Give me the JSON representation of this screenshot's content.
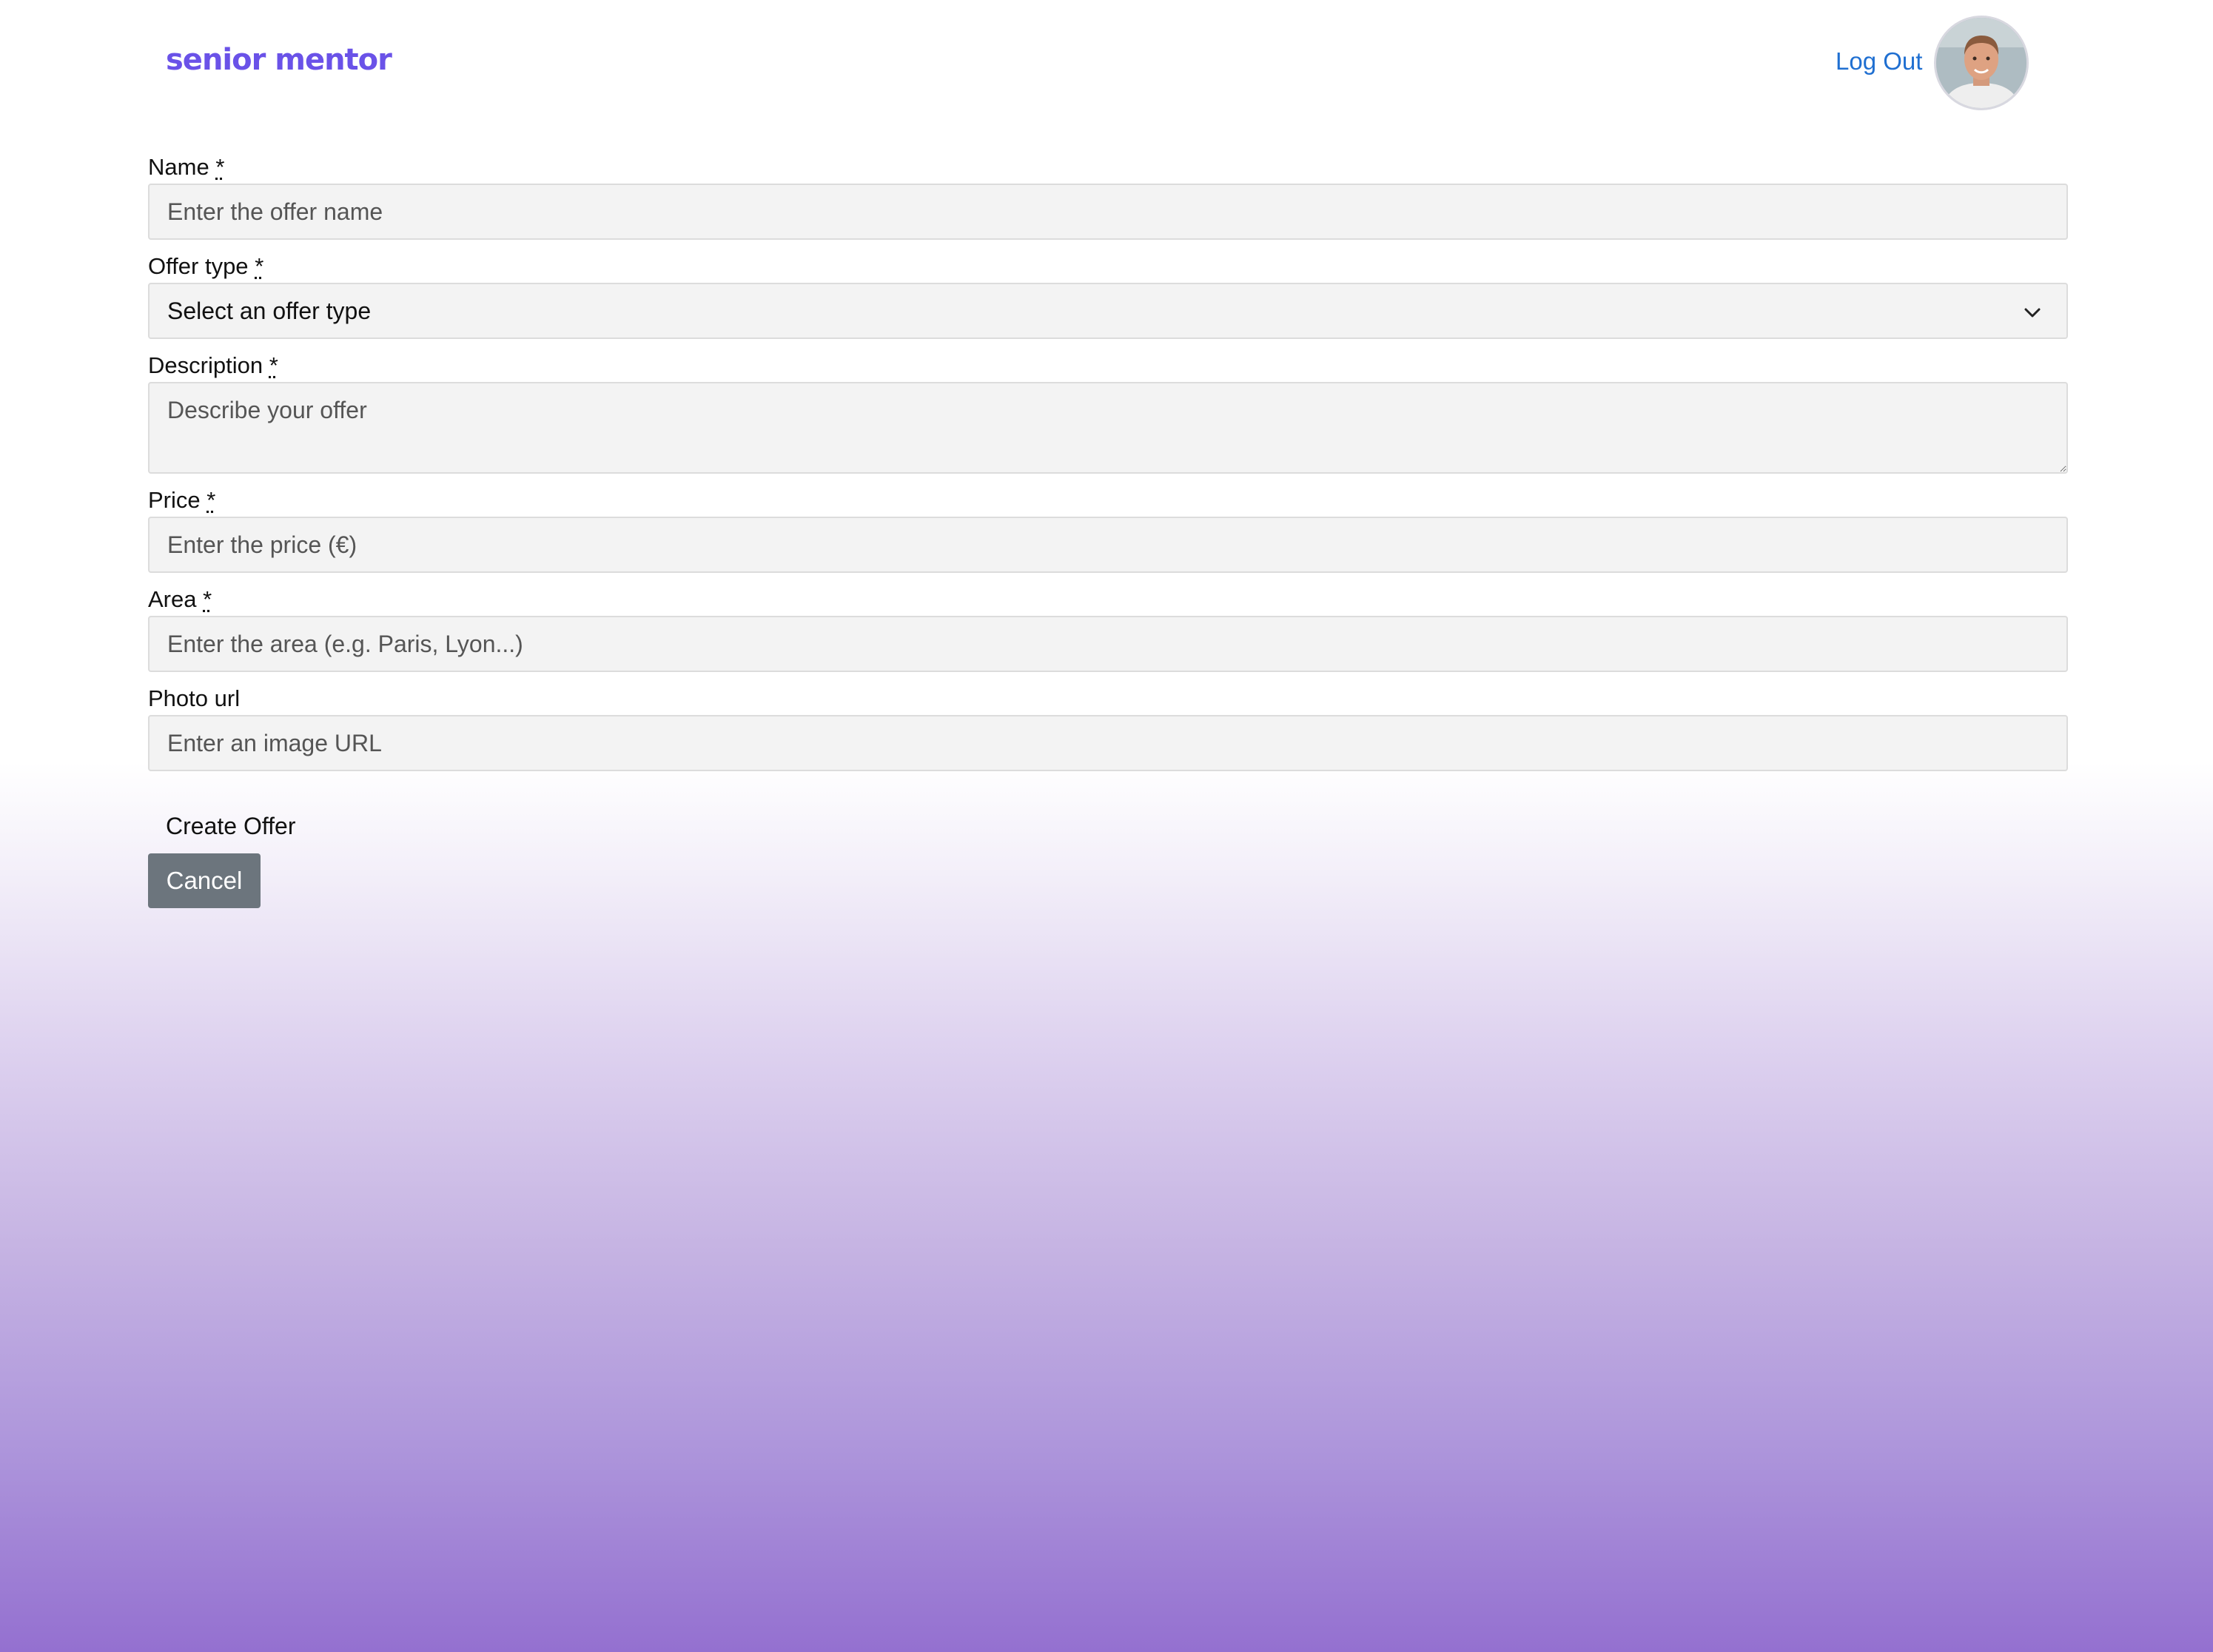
{
  "header": {
    "brand": "senior mentor",
    "logout_label": "Log Out",
    "avatar_alt": "avatar"
  },
  "form": {
    "name": {
      "label": "Name",
      "required_mark": "*",
      "placeholder": "Enter the offer name",
      "value": ""
    },
    "offer_type": {
      "label": "Offer type",
      "required_mark": "*",
      "selected": "Select an offer type"
    },
    "description": {
      "label": "Description",
      "required_mark": "*",
      "placeholder": "Describe your offer",
      "value": ""
    },
    "price": {
      "label": "Price",
      "required_mark": "*",
      "placeholder": "Enter the price (€)",
      "value": ""
    },
    "area": {
      "label": "Area",
      "required_mark": "*",
      "placeholder": "Enter the area (e.g. Paris, Lyon...)",
      "value": ""
    },
    "photo_url": {
      "label": "Photo url",
      "placeholder": "Enter an image URL",
      "value": ""
    },
    "create_label": "Create Offer",
    "cancel_label": "Cancel"
  },
  "colors": {
    "brand": "#6a52e8",
    "link": "#1f6fd1",
    "cancel_bg": "#6c757d",
    "gradient_bottom": "#9470d0"
  }
}
